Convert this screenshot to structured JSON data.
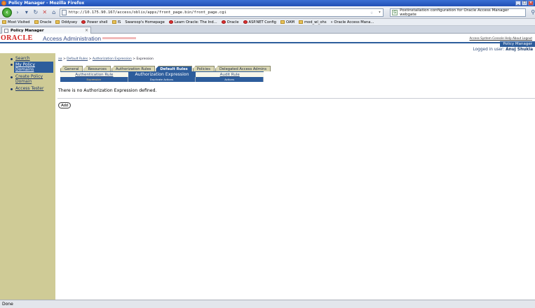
{
  "window": {
    "title": "Policy Manager - Mozilla Firefox"
  },
  "browser": {
    "url": "http://10.175.90.167/access/oblix/apps/front_page.bin/front_page.cgi",
    "search_text": "Postinstallation configuration for Oracle Access Manager webgate",
    "bookmarks": [
      "Most Visited",
      "Oracle",
      "Oddysey",
      "Power shell",
      "IS",
      "Swaroop's Homepage",
      "Learn Oracle: The Ind...",
      "Oracle",
      "ASP.NET Config",
      "OAM",
      "mod_wl_ohs",
      "» Oracle Access Mana..."
    ],
    "tab_title": "Policy Manager",
    "status": "Done"
  },
  "header": {
    "logo": "ORACLE",
    "app_title": "Access Administration",
    "top_links": "Access System Console Help About Logout",
    "app_badge": "Policy Manager",
    "logged_in_label": "Logged in user:",
    "logged_in_user": "Anuj Shukla"
  },
  "sidebar": {
    "items": [
      "Search",
      "My Policy Domains",
      "Create Policy Domain",
      "Access Tester"
    ]
  },
  "breadcrumb": {
    "items": [
      "aa",
      "Default Rules",
      "Authorization Expression",
      "Expression"
    ]
  },
  "tabs": {
    "main": [
      "General",
      "Resources",
      "Authorization Rules",
      "Default Rules",
      "Policies",
      "Delegated Access Admins"
    ],
    "sub": [
      "Authentication Rule",
      "Authorization Expression",
      "Audit Rule"
    ],
    "columns": [
      "Expression",
      "Duplicate Actions",
      "Actions"
    ]
  },
  "content": {
    "message": "There is no Authorization Expression defined.",
    "add_button": "Add"
  }
}
